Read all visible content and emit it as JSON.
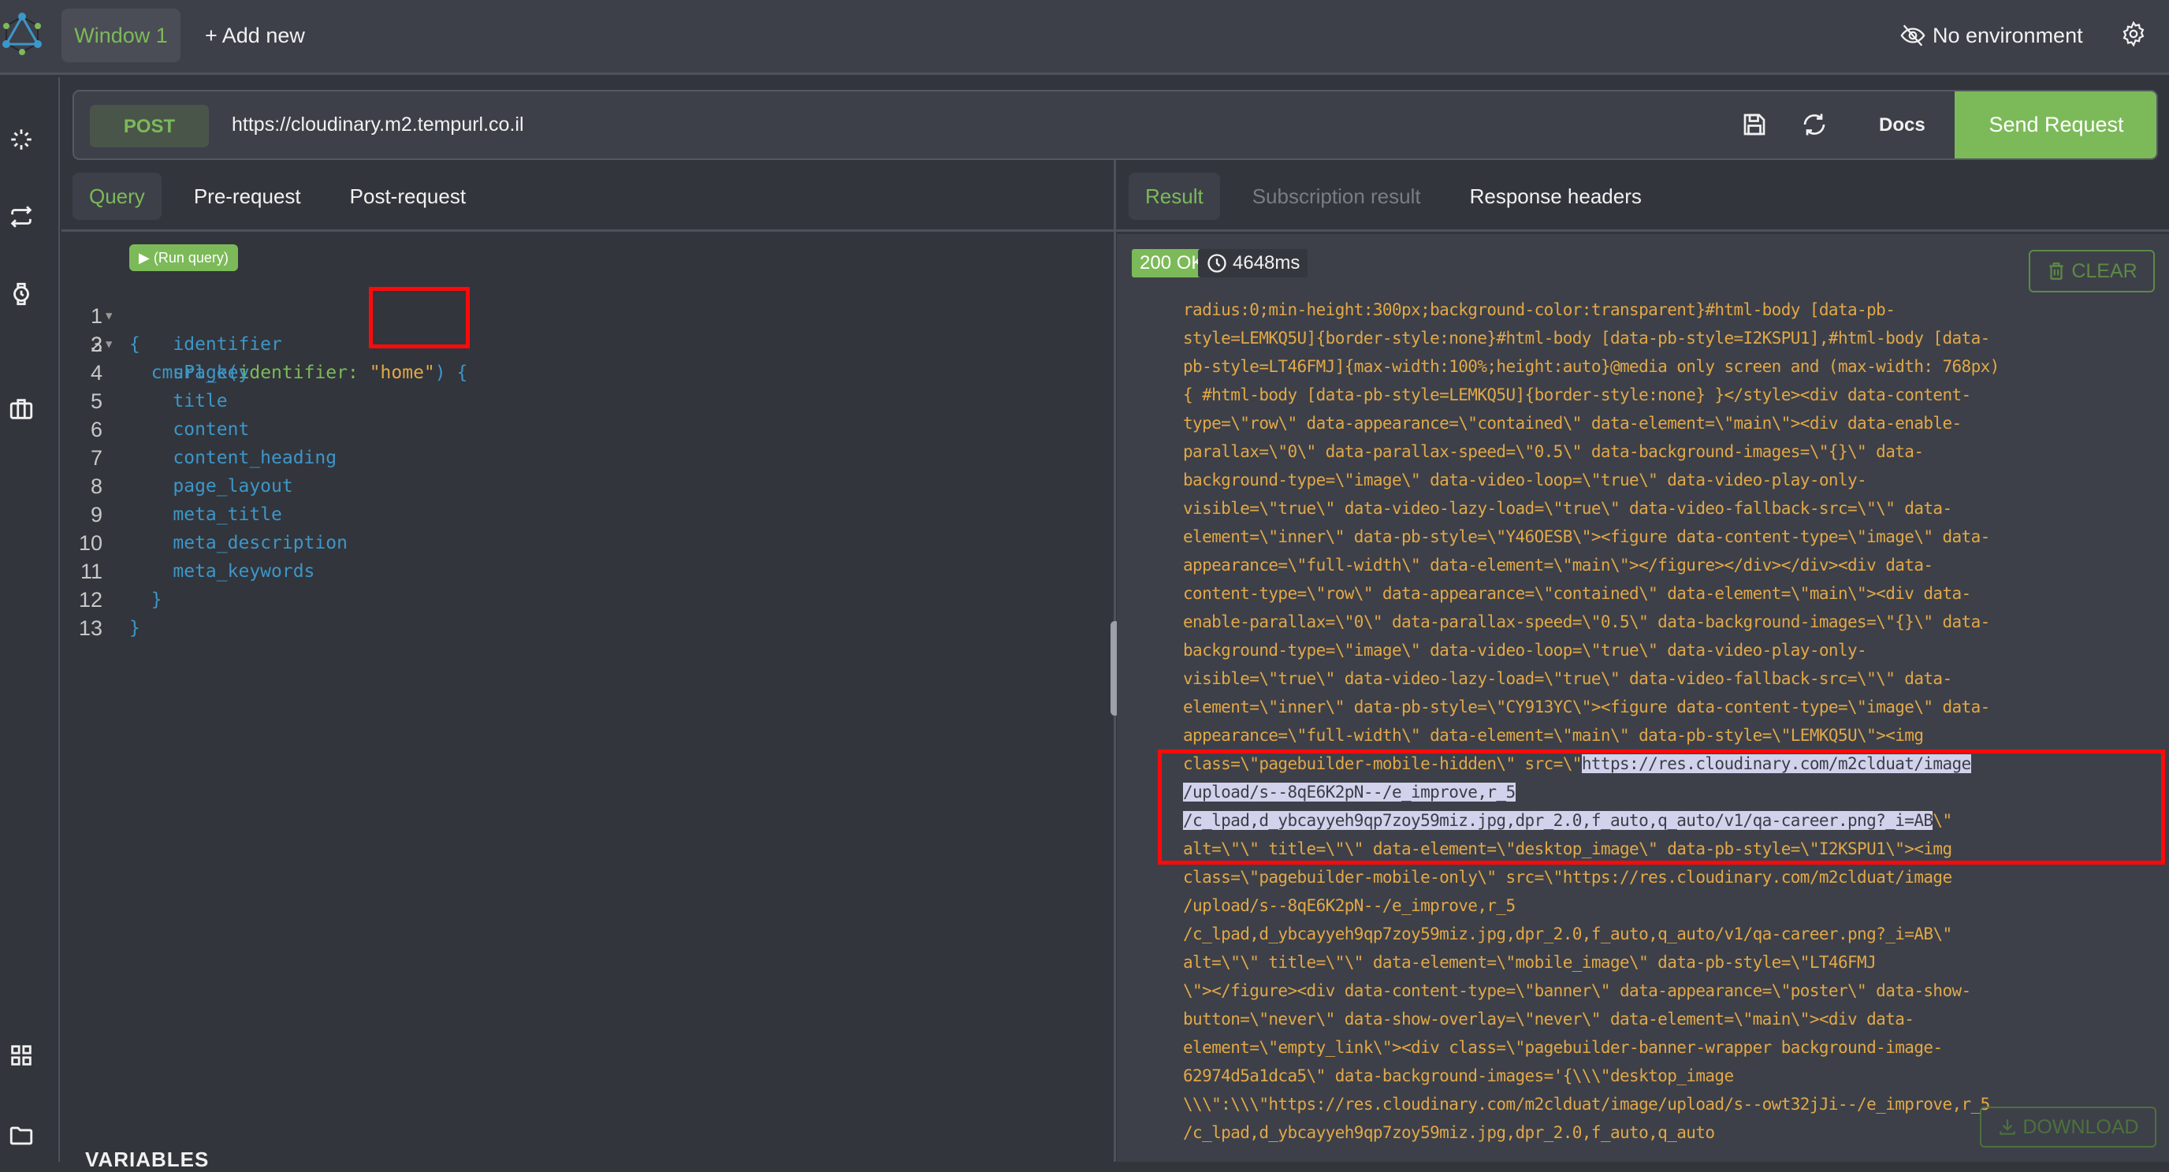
{
  "topbar": {
    "window_tab": "Window 1",
    "add_new": "+ Add new",
    "environment": "No environment"
  },
  "sidebar": {
    "icons": [
      "sparkle-icon",
      "swap-icon",
      "watch-icon",
      "briefcase-icon",
      "grid-icon",
      "folder-icon"
    ]
  },
  "request": {
    "method": "POST",
    "url": "https://cloudinary.m2.tempurl.co.il",
    "docs_label": "Docs",
    "send_label": "Send Request"
  },
  "query_tabs": [
    {
      "label": "Query",
      "active": true
    },
    {
      "label": "Pre-request",
      "active": false
    },
    {
      "label": "Post-request",
      "active": false
    }
  ],
  "result_tabs": [
    {
      "label": "Result",
      "active": true
    },
    {
      "label": "Subscription result",
      "disabled": true
    },
    {
      "label": "Response headers",
      "active": false
    }
  ],
  "editor": {
    "run_query": "▶ (Run query)",
    "lines": [
      {
        "n": "1",
        "fold": true,
        "text": "{"
      },
      {
        "n": "2",
        "fold": true,
        "fn": "cmsPage",
        "arg": "identifier:",
        "value": "\"home\"",
        "rest": ") {"
      },
      {
        "n": "3",
        "text": "    identifier"
      },
      {
        "n": "4",
        "text": "    url_key"
      },
      {
        "n": "5",
        "text": "    title"
      },
      {
        "n": "6",
        "text": "    content"
      },
      {
        "n": "7",
        "text": "    content_heading"
      },
      {
        "n": "8",
        "text": "    page_layout"
      },
      {
        "n": "9",
        "text": "    meta_title"
      },
      {
        "n": "10",
        "text": "    meta_description"
      },
      {
        "n": "11",
        "text": "    meta_keywords"
      },
      {
        "n": "12",
        "text": "  }"
      },
      {
        "n": "13",
        "text": "}"
      }
    ],
    "variables_label": "VARIABLES"
  },
  "result": {
    "status": "200 OK",
    "time": "4648ms",
    "clear_label": "CLEAR",
    "download_label": "DOWNLOAD",
    "lines": [
      "radius:0;min-height:300px;background-color:transparent}#html-body [data-pb-",
      "style=LEMKQ5U]{border-style:none}#html-body [data-pb-style=I2KSPU1],#html-body [data-",
      "pb-style=LT46FMJ]{max-width:100%;height:auto}@media only screen and (max-width: 768px)",
      "{ #html-body [data-pb-style=LEMKQ5U]{border-style:none} }</style><div data-content-",
      "type=\\\"row\\\" data-appearance=\\\"contained\\\" data-element=\\\"main\\\"><div data-enable-",
      "parallax=\\\"0\\\" data-parallax-speed=\\\"0.5\\\" data-background-images=\\\"{}\\\" data-",
      "background-type=\\\"image\\\" data-video-loop=\\\"true\\\" data-video-play-only-",
      "visible=\\\"true\\\" data-video-lazy-load=\\\"true\\\" data-video-fallback-src=\\\"\\\" data-",
      "element=\\\"inner\\\" data-pb-style=\\\"Y46OESB\\\"><figure data-content-type=\\\"image\\\" data-",
      "appearance=\\\"full-width\\\" data-element=\\\"main\\\"></figure></div></div><div data-",
      "content-type=\\\"row\\\" data-appearance=\\\"contained\\\" data-element=\\\"main\\\"><div data-",
      "enable-parallax=\\\"0\\\" data-parallax-speed=\\\"0.5\\\" data-background-images=\\\"{}\\\" data-",
      "background-type=\\\"image\\\" data-video-loop=\\\"true\\\" data-video-play-only-",
      "visible=\\\"true\\\" data-video-lazy-load=\\\"true\\\" data-video-fallback-src=\\\"\\\" data-",
      "element=\\\"inner\\\" data-pb-style=\\\"CY913YC\\\"><figure data-content-type=\\\"image\\\" data-",
      "appearance=\\\"full-width\\\" data-element=\\\"main\\\" data-pb-style=\\\"LEMKQ5U\\\"><img"
    ],
    "highlight_prefix": "class=\\\"pagebuilder-mobile-hidden\\\" src=\\\"",
    "highlight_1": "https://res.cloudinary.com/m2clduat/image",
    "highlight_2": "/upload/s--8qE6K2pN--/e_improve,r_5",
    "highlight_3": "/c_lpad,d_ybcayyeh9qp7zoy59miz.jpg,dpr_2.0,f_auto,q_auto/v1/qa-career.png?_i=AB",
    "highlight_suffix": "\\\"",
    "lines_after": [
      "alt=\\\"\\\" title=\\\"\\\" data-element=\\\"desktop_image\\\" data-pb-style=\\\"I2KSPU1\\\"><img",
      "class=\\\"pagebuilder-mobile-only\\\" src=\\\"https://res.cloudinary.com/m2clduat/image",
      "/upload/s--8qE6K2pN--/e_improve,r_5",
      "/c_lpad,d_ybcayyeh9qp7zoy59miz.jpg,dpr_2.0,f_auto,q_auto/v1/qa-career.png?_i=AB\\\"",
      "alt=\\\"\\\" title=\\\"\\\" data-element=\\\"mobile_image\\\" data-pb-style=\\\"LT46FMJ",
      "\\\"></figure><div data-content-type=\\\"banner\\\" data-appearance=\\\"poster\\\" data-show-",
      "button=\\\"never\\\" data-show-overlay=\\\"never\\\" data-element=\\\"main\\\"><div data-",
      "element=\\\"empty_link\\\"><div class=\\\"pagebuilder-banner-wrapper background-image-",
      "62974d5a1dca5\\\" data-background-images='{\\\\\\\"desktop_image",
      "\\\\\\\":\\\\\\\"https://res.cloudinary.com/m2clduat/image/upload/s--owt32jJi--/e_improve,r_5",
      "/c_lpad,d_ybcayyeh9qp7zoy59miz.jpg,dpr_2.0,f_auto,q_auto"
    ]
  },
  "colors": {
    "accent": "#7cba59",
    "code_keyword": "#3d96c9",
    "code_string": "#e2a847",
    "annotation": "#ff0a0a"
  }
}
